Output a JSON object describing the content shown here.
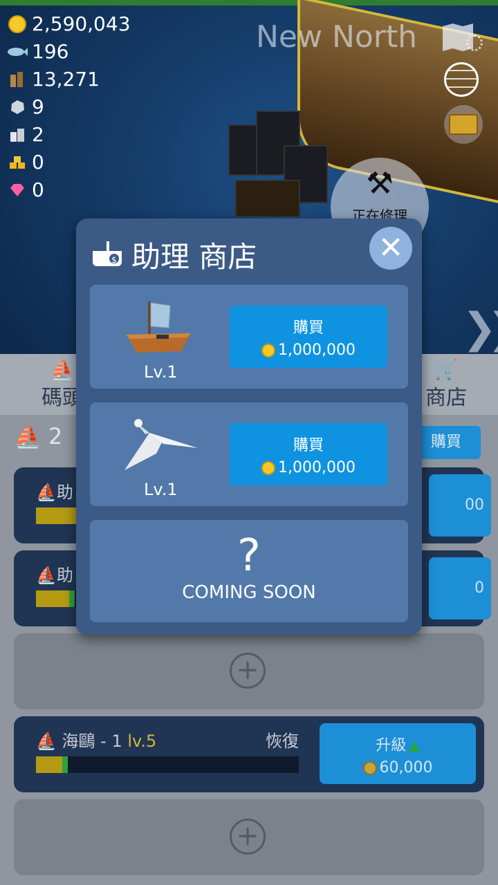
{
  "resources": [
    {
      "icon": "gold-coin-icon",
      "value": "2,590,043"
    },
    {
      "icon": "fish-icon",
      "value": "196"
    },
    {
      "icon": "wood-icon",
      "value": "13,271"
    },
    {
      "icon": "ore-icon",
      "value": "9"
    },
    {
      "icon": "building-icon",
      "value": "2"
    },
    {
      "icon": "gold-bar-icon",
      "value": "0"
    },
    {
      "icon": "gem-icon",
      "value": "0"
    }
  ],
  "region": "New North",
  "repair": {
    "label": "正在修理"
  },
  "tabs": {
    "dock": "碼頭",
    "shop": "商店"
  },
  "summary": {
    "count": "2"
  },
  "buy_small": "購買",
  "cards": [
    {
      "name": "助",
      "right_value": "00"
    },
    {
      "name": "助",
      "right_value": "0"
    },
    {
      "name": "海鷗 - 1",
      "level": "lv.5",
      "status": "恢復",
      "upgrade_label": "升級",
      "upgrade_cost": "60,000",
      "progress": 0.12
    }
  ],
  "modal": {
    "title": "助理 商店",
    "items": [
      {
        "name": "boat-assistant",
        "level": "Lv.1",
        "buy_label": "購買",
        "price": "1,000,000"
      },
      {
        "name": "seagull-assistant",
        "level": "Lv.1",
        "buy_label": "購買",
        "price": "1,000,000"
      }
    ],
    "coming_soon": {
      "mark": "?",
      "label": "COMING SOON"
    }
  },
  "colors": {
    "buy_button": "#0f93e0",
    "modal_bg": "#3c5a86",
    "item_bg": "#5379aa",
    "coin": "#f6c928"
  }
}
